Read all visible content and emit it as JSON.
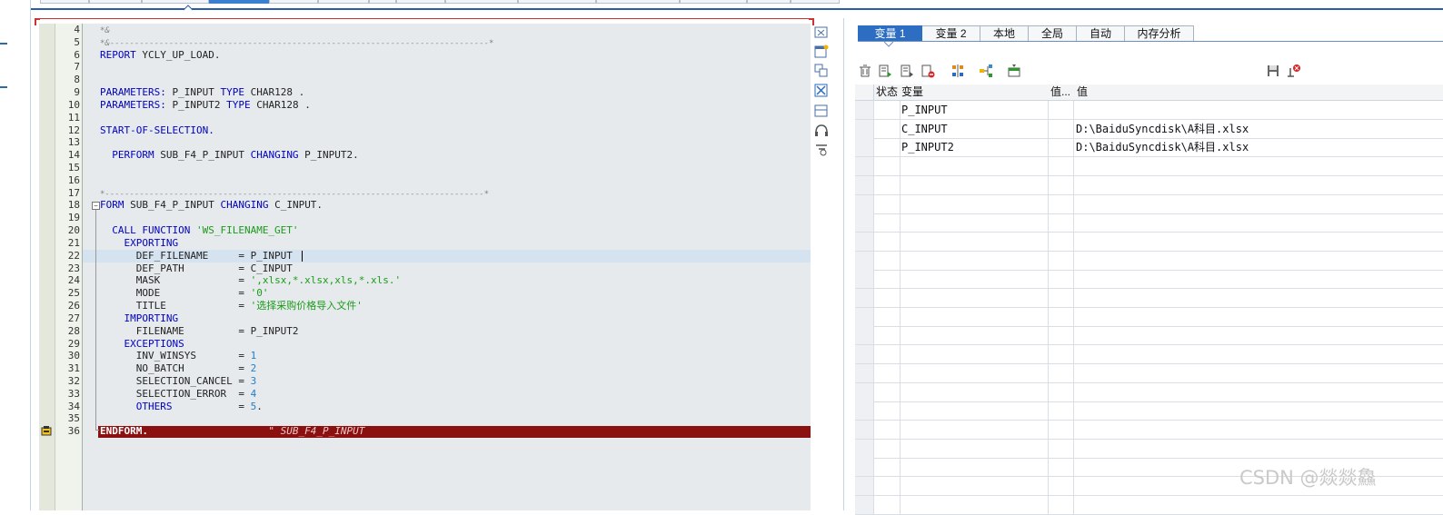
{
  "code_lines": [
    {
      "num": "4",
      "parts": [
        {
          "t": "*&",
          "c": "cmt"
        }
      ]
    },
    {
      "num": "5",
      "parts": [
        {
          "t": "*&-----------------------------------------------------------------------------*",
          "c": "cmt"
        }
      ]
    },
    {
      "num": "6",
      "parts": [
        {
          "t": "REPORT",
          "c": "kw"
        },
        {
          "t": " YCLY_UP_LOAD.",
          "c": "tx"
        }
      ]
    },
    {
      "num": "7",
      "parts": []
    },
    {
      "num": "8",
      "parts": []
    },
    {
      "num": "9",
      "parts": [
        {
          "t": "PARAMETERS:",
          "c": "kw"
        },
        {
          "t": " P_INPUT ",
          "c": "tx"
        },
        {
          "t": "TYPE",
          "c": "kw"
        },
        {
          "t": " CHAR128 .",
          "c": "tx"
        }
      ]
    },
    {
      "num": "10",
      "parts": [
        {
          "t": "PARAMETERS:",
          "c": "kw"
        },
        {
          "t": " P_INPUT2 ",
          "c": "tx"
        },
        {
          "t": "TYPE",
          "c": "kw"
        },
        {
          "t": " CHAR128 .",
          "c": "tx"
        }
      ]
    },
    {
      "num": "11",
      "parts": []
    },
    {
      "num": "12",
      "parts": [
        {
          "t": "START-OF-SELECTION.",
          "c": "kw"
        }
      ]
    },
    {
      "num": "13",
      "parts": []
    },
    {
      "num": "14",
      "parts": [
        {
          "t": "  PERFORM",
          "c": "kw"
        },
        {
          "t": " SUB_F4_P_INPUT ",
          "c": "tx"
        },
        {
          "t": "CHANGING",
          "c": "kw"
        },
        {
          "t": " P_INPUT2.",
          "c": "tx"
        }
      ]
    },
    {
      "num": "15",
      "parts": []
    },
    {
      "num": "16",
      "parts": []
    },
    {
      "num": "17",
      "parts": [
        {
          "t": "*-----------------------------------------------------------------------------*",
          "c": "cmt"
        }
      ]
    },
    {
      "num": "18",
      "parts": [
        {
          "t": "FORM",
          "c": "kw"
        },
        {
          "t": " SUB_F4_P_INPUT ",
          "c": "tx"
        },
        {
          "t": "CHANGING",
          "c": "kw"
        },
        {
          "t": " C_INPUT.",
          "c": "tx"
        }
      ]
    },
    {
      "num": "19",
      "parts": []
    },
    {
      "num": "20",
      "parts": [
        {
          "t": "  CALL FUNCTION",
          "c": "kw"
        },
        {
          "t": " 'WS_FILENAME_GET'",
          "c": "str"
        }
      ]
    },
    {
      "num": "21",
      "parts": [
        {
          "t": "    EXPORTING",
          "c": "kw"
        }
      ]
    },
    {
      "num": "22",
      "parts": [
        {
          "t": "      DEF_FILENAME     = P_INPUT",
          "c": "tx"
        }
      ]
    },
    {
      "num": "23",
      "parts": [
        {
          "t": "      DEF_PATH         = C_INPUT",
          "c": "tx"
        }
      ]
    },
    {
      "num": "24",
      "parts": [
        {
          "t": "      MASK             = ",
          "c": "tx"
        },
        {
          "t": "',xlsx,*.xlsx,xls,*.xls.'",
          "c": "str"
        }
      ]
    },
    {
      "num": "25",
      "parts": [
        {
          "t": "      MODE             = ",
          "c": "tx"
        },
        {
          "t": "'0'",
          "c": "str"
        }
      ]
    },
    {
      "num": "26",
      "parts": [
        {
          "t": "      TITLE            = ",
          "c": "tx"
        },
        {
          "t": "'选择采购价格导入文件'",
          "c": "str"
        }
      ]
    },
    {
      "num": "27",
      "parts": [
        {
          "t": "    IMPORTING",
          "c": "kw"
        }
      ]
    },
    {
      "num": "28",
      "parts": [
        {
          "t": "      FILENAME         = P_INPUT2",
          "c": "tx"
        }
      ]
    },
    {
      "num": "29",
      "parts": [
        {
          "t": "    EXCEPTIONS",
          "c": "kw"
        }
      ]
    },
    {
      "num": "30",
      "parts": [
        {
          "t": "      INV_WINSYS       = ",
          "c": "tx"
        },
        {
          "t": "1",
          "c": "num"
        }
      ]
    },
    {
      "num": "31",
      "parts": [
        {
          "t": "      NO_BATCH         = ",
          "c": "tx"
        },
        {
          "t": "2",
          "c": "num"
        }
      ]
    },
    {
      "num": "32",
      "parts": [
        {
          "t": "      SELECTION_CANCEL = ",
          "c": "tx"
        },
        {
          "t": "3",
          "c": "num"
        }
      ]
    },
    {
      "num": "33",
      "parts": [
        {
          "t": "      SELECTION_ERROR  = ",
          "c": "tx"
        },
        {
          "t": "4",
          "c": "num"
        }
      ]
    },
    {
      "num": "34",
      "parts": [
        {
          "t": "      OTHERS",
          "c": "kw"
        },
        {
          "t": "           = ",
          "c": "tx"
        },
        {
          "t": "5",
          "c": "num"
        },
        {
          "t": ".",
          "c": "tx"
        }
      ]
    },
    {
      "num": "35",
      "parts": []
    },
    {
      "num": "36",
      "parts": [
        {
          "t": "ENDFORM.",
          "c": "wht"
        },
        {
          "t": "                    \" SUB_F4_P_INPUT",
          "c": "wcm"
        }
      ]
    }
  ],
  "var_tabs": [
    "变量 1",
    "变量 2",
    "本地",
    "全局",
    "自动",
    "内存分析"
  ],
  "var_tabs_active": 0,
  "var_table": {
    "headers": [
      "状态",
      "变量",
      "值...",
      "值"
    ],
    "rows": [
      {
        "var": "P_INPUT",
        "value": ""
      },
      {
        "var": "C_INPUT",
        "value": "D:\\BaiduSyncdisk\\A科目.xlsx"
      },
      {
        "var": "P_INPUT2",
        "value": "D:\\BaiduSyncdisk\\A科目.xlsx"
      }
    ],
    "empty_rows": 19
  },
  "toolbar_icons": [
    "delete-icon",
    "display-icon",
    "display-list-icon",
    "remove-icon",
    "sort-icon",
    "tree-icon",
    "export-icon"
  ],
  "toolbar_right_icons": [
    "save-icon",
    "reset-icon"
  ],
  "side_tools": [
    "close-window-icon",
    "new-window-icon",
    "copy-icon",
    "crossed-box-icon",
    "split-icon",
    "headset-icon",
    "settings-icon"
  ],
  "watermark": "CSDN @燚燚鱻",
  "colors": {
    "keyword": "#0000c0",
    "string": "#1b9b1b",
    "number": "#2080d0",
    "comment": "#808080",
    "exec_line": "#8b1010",
    "active_tab": "#2d6ec2"
  }
}
